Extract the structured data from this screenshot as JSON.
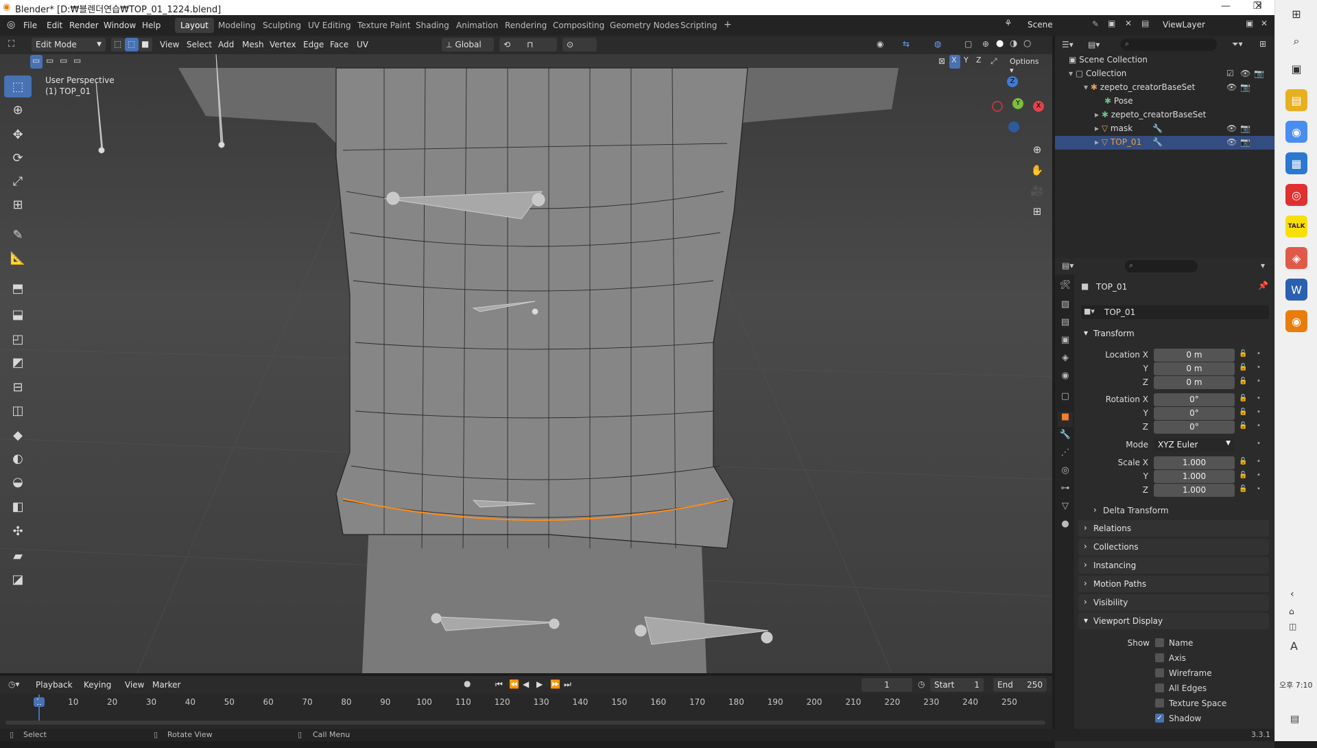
{
  "window": {
    "title": "Blender* [D:₩블렌더연습₩TOP_01_1224.blend]",
    "min_glyph": "—",
    "restore_glyph": "❐",
    "close_glyph": "✕"
  },
  "menubar": {
    "items": [
      "File",
      "Edit",
      "Render",
      "Window",
      "Help"
    ],
    "workspaces": [
      "Layout",
      "Modeling",
      "Sculpting",
      "UV Editing",
      "Texture Paint",
      "Shading",
      "Animation",
      "Rendering",
      "Compositing",
      "Geometry Nodes",
      "Scripting"
    ],
    "add_tab": "+",
    "active_workspace": "Layout",
    "scene": "Scene",
    "view_layer": "ViewLayer"
  },
  "viewport_header": {
    "mode": "Edit Mode",
    "menus": [
      "View",
      "Select",
      "Add",
      "Mesh",
      "Vertex",
      "Edge",
      "Face",
      "UV"
    ],
    "orientation": "Global",
    "options_label": "Options",
    "axis_x": "X",
    "axis_y": "Y",
    "axis_z": "Z"
  },
  "viewport": {
    "perspective": "User Perspective",
    "object_label": "(1) TOP_01",
    "gizmo": {
      "x": "X",
      "y": "Y",
      "z": "Z"
    }
  },
  "toolbar": {
    "tools": [
      "select-box",
      "cursor",
      "move",
      "rotate",
      "scale",
      "transform",
      "annotate",
      "measure",
      "add-cube",
      "extrude",
      "inset",
      "bevel",
      "loop-cut",
      "knife",
      "poly-build",
      "spin",
      "smooth",
      "edge-slide",
      "shrink-fatten",
      "shear",
      "rip"
    ]
  },
  "outliner": {
    "search_placeholder": "",
    "items": [
      {
        "label": "Scene Collection",
        "icon": "scene-collection-icon"
      },
      {
        "label": "Collection",
        "icon": "collection-icon"
      },
      {
        "label": "zepeto_creatorBaseSet",
        "icon": "armature-icon"
      },
      {
        "label": "Pose",
        "icon": "pose-icon"
      },
      {
        "label": "zepeto_creatorBaseSet",
        "icon": "armature-data-icon"
      },
      {
        "label": "mask",
        "icon": "mesh-icon"
      },
      {
        "label": "TOP_01",
        "icon": "mesh-icon",
        "selected": true
      }
    ]
  },
  "properties": {
    "object_name": "TOP_01",
    "object_field": "TOP_01",
    "transform": {
      "title": "Transform",
      "location_label": "Location X",
      "location": [
        "0 m",
        "0 m",
        "0 m"
      ],
      "rotation_label": "Rotation X",
      "rotation": [
        "0°",
        "0°",
        "0°"
      ],
      "mode_label": "Mode",
      "mode": "XYZ Euler",
      "scale_label": "Scale X",
      "scale": [
        "1.000",
        "1.000",
        "1.000"
      ],
      "y": "Y",
      "z": "Z"
    },
    "delta_transform": "Delta Transform",
    "sections": [
      "Relations",
      "Collections",
      "Instancing",
      "Motion Paths",
      "Visibility"
    ],
    "viewport_display": "Viewport Display",
    "show_label": "Show",
    "show_items": [
      {
        "label": "Name",
        "checked": false
      },
      {
        "label": "Axis",
        "checked": false
      },
      {
        "label": "Wireframe",
        "checked": false
      },
      {
        "label": "All Edges",
        "checked": false
      },
      {
        "label": "Texture Space",
        "checked": false
      },
      {
        "label": "Shadow",
        "checked": true
      }
    ]
  },
  "timeline": {
    "menus": [
      "Playback",
      "Keying",
      "View",
      "Marker"
    ],
    "current_frame": "1",
    "start_label": "Start",
    "start": "1",
    "end_label": "End",
    "end": "250",
    "ruler": [
      "1",
      "10",
      "20",
      "30",
      "40",
      "50",
      "60",
      "70",
      "80",
      "90",
      "100",
      "110",
      "120",
      "130",
      "140",
      "150",
      "160",
      "170",
      "180",
      "190",
      "200",
      "210",
      "220",
      "230",
      "240",
      "250"
    ]
  },
  "statusbar": {
    "select": "Select",
    "rotate": "Rotate View",
    "call_menu": "Call Menu",
    "version": "3.3.1"
  },
  "taskbar": {
    "time": "오후 7:10",
    "ime": "A",
    "kakao": "TALK"
  },
  "colors": {
    "accent": "#4772b3",
    "selected_row": "#334d80",
    "active_edge": "#ff8c1a",
    "orange_tab": "#f08030"
  }
}
